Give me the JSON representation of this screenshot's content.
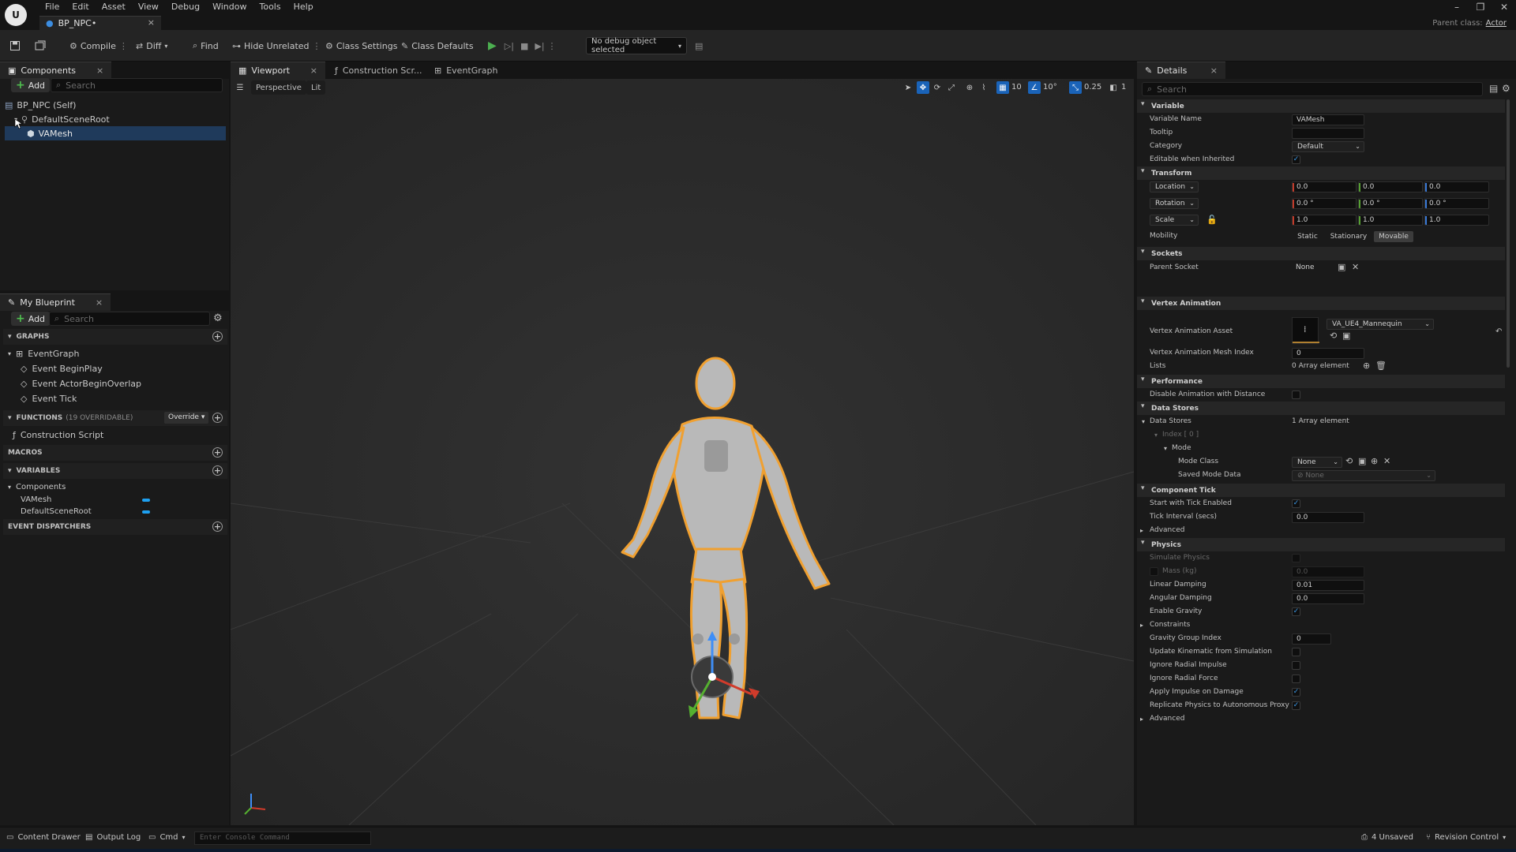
{
  "app": {
    "logo_text": "U",
    "menus": [
      "File",
      "Edit",
      "Asset",
      "View",
      "Debug",
      "Window",
      "Tools",
      "Help"
    ],
    "document_tab": "BP_NPC•",
    "parent_class_label": "Parent class:",
    "parent_class_value": "Actor"
  },
  "toolbar": {
    "compile": "Compile",
    "diff": "Diff",
    "find": "Find",
    "hide_unrelated": "Hide Unrelated",
    "class_settings": "Class Settings",
    "class_defaults": "Class Defaults",
    "debug_object": "No debug object selected"
  },
  "components": {
    "tab": "Components",
    "add": "Add",
    "search_placeholder": "Search",
    "tree": [
      "BP_NPC (Self)",
      "DefaultSceneRoot",
      "VAMesh"
    ]
  },
  "my_blueprint": {
    "tab": "My Blueprint",
    "add": "Add",
    "search_placeholder": "Search",
    "graphs_header": "GRAPHS",
    "graphs_root": "EventGraph",
    "graph_events": [
      "Event BeginPlay",
      "Event ActorBeginOverlap",
      "Event Tick"
    ],
    "functions_header": "FUNCTIONS",
    "functions_count": "(19 OVERRIDABLE)",
    "override_label": "Override",
    "functions": [
      "Construction Script"
    ],
    "macros_header": "MACROS",
    "variables_header": "VARIABLES",
    "variables_group": "Components",
    "variables": [
      "VAMesh",
      "DefaultSceneRoot"
    ],
    "dispatchers_header": "EVENT DISPATCHERS"
  },
  "viewport": {
    "tabs": [
      "Viewport",
      "Construction Scr...",
      "EventGraph"
    ],
    "perspective": "Perspective",
    "lit": "Lit",
    "grid_snap": "10",
    "rot_snap": "10°",
    "scale_snap": "0.25",
    "camera_speed": "1"
  },
  "details": {
    "tab": "Details",
    "search_placeholder": "Search",
    "sections": {
      "variable": "Variable",
      "transform": "Transform",
      "sockets": "Sockets",
      "vertex_animation": "Vertex Animation",
      "performance": "Performance",
      "data_stores": "Data Stores",
      "component_tick": "Component Tick",
      "physics": "Physics"
    },
    "labels": {
      "variable_name": "Variable Name",
      "tooltip": "Tooltip",
      "category": "Category",
      "editable_inherited": "Editable when Inherited",
      "location": "Location",
      "rotation": "Rotation",
      "scale": "Scale",
      "mobility": "Mobility",
      "parent_socket": "Parent Socket",
      "va_asset": "Vertex Animation Asset",
      "va_mesh_index": "Vertex Animation Mesh Index",
      "lists": "Lists",
      "disable_anim": "Disable Animation with Distance",
      "data_stores": "Data Stores",
      "index0": "Index [ 0 ]",
      "mode": "Mode",
      "mode_class": "Mode Class",
      "saved_mode_data": "Saved Mode Data",
      "start_tick": "Start with Tick Enabled",
      "tick_interval": "Tick Interval (secs)",
      "advanced": "Advanced",
      "simulate_physics": "Simulate Physics",
      "mass": "Mass (kg)",
      "linear_damping": "Linear Damping",
      "angular_damping": "Angular Damping",
      "enable_gravity": "Enable Gravity",
      "constraints": "Constraints",
      "gravity_group": "Gravity Group Index",
      "update_kinematic": "Update Kinematic from Simulation",
      "ignore_radial_impulse": "Ignore Radial Impulse",
      "ignore_radial_force": "Ignore Radial Force",
      "apply_impulse": "Apply Impulse on Damage",
      "replicate_physics": "Replicate Physics to Autonomous Proxy",
      "advanced2": "Advanced"
    },
    "values": {
      "variable_name": "VAMesh",
      "tooltip": "",
      "category": "Default",
      "location": [
        "0.0",
        "0.0",
        "0.0"
      ],
      "rotation": [
        "0.0 °",
        "0.0 °",
        "0.0 °"
      ],
      "scale": [
        "1.0",
        "1.0",
        "1.0"
      ],
      "mobility_options": [
        "Static",
        "Stationary",
        "Movable"
      ],
      "parent_socket": "None",
      "va_asset": "VA_UE4_Mannequin",
      "va_mesh_index": "0",
      "lists": "0 Array element",
      "data_stores": "1 Array element",
      "mode_class": "None",
      "saved_mode_data": "None",
      "tick_interval": "0.0",
      "mass": "0.0",
      "linear_damping": "0.01",
      "angular_damping": "0.0",
      "gravity_group": "0"
    }
  },
  "statusbar": {
    "content_drawer": "Content Drawer",
    "output_log": "Output Log",
    "cmd": "Cmd",
    "console_placeholder": "Enter Console Command",
    "unsaved": "4 Unsaved",
    "revision_control": "Revision Control"
  },
  "colors": {
    "selection": "#1f3a5b",
    "accent_blue": "#1a63b8",
    "outline_orange": "#f0a030",
    "play_green": "#4caf50"
  }
}
